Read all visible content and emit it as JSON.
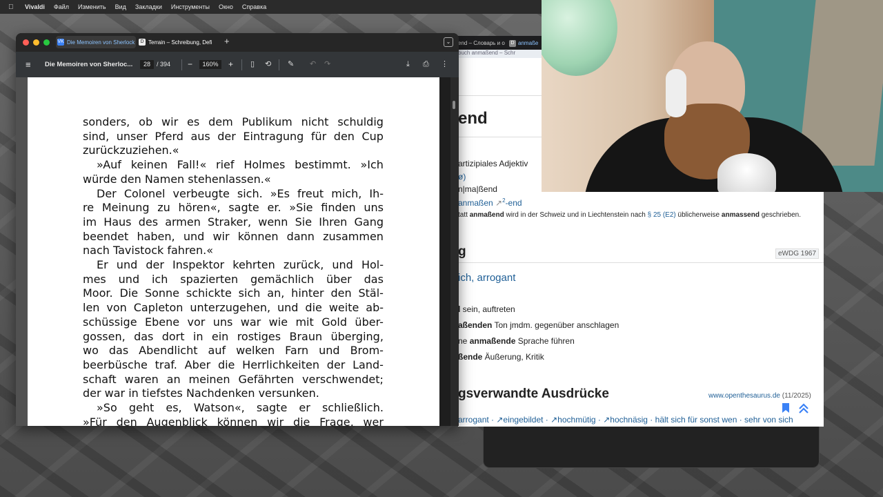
{
  "menubar": {
    "app": "Vivaldi",
    "items": [
      "Файл",
      "Изменить",
      "Вид",
      "Закладки",
      "Инструменты",
      "Окно",
      "Справка"
    ]
  },
  "browser": {
    "tabs": [
      {
        "favicon": "VK",
        "title": "Die Memoiren von Sherlock"
      },
      {
        "favicon": "D",
        "title": "Terrain – Schreibung, Defi"
      }
    ]
  },
  "pdf_toolbar": {
    "title": "Die Memoiren von Sherloc...",
    "page": "28",
    "total": "/ 394",
    "zoom": "160%"
  },
  "pdf_text": [
    "sonders, ob wir es dem Publikum nicht schuldig",
    "sind, unser Pferd aus der Eintragung für den Cup",
    "zurückzuziehen.«",
    "»Auf keinen Fall!« rief Holmes bestimmt. »Ich",
    "würde den Namen stehenlassen.«",
    "Der Colonel verbeugte sich. »Es freut mich, Ih-",
    "re Meinung zu hören«, sagte er. »Sie finden uns",
    "im Haus des armen Straker, wenn Sie Ihren Gang",
    "beendet haben, und wir können dann zusammen",
    "nach Tavistock fahren.«",
    "Er und der Inspektor kehrten zurück, und Hol-",
    "mes und ich spazierten gemächlich über das",
    "Moor. Die Sonne schickte sich an, hinter den Stäl-",
    "len von Capleton unterzugehen, und die weite ab-",
    "schüssige Ebene vor uns war wie mit Gold über-",
    "gossen, das dort in ein rostiges Braun überging,",
    "wo das Abendlicht auf welken Farn und Brom-",
    "beerbüsche traf. Aber die Herrlichkeiten der Land-",
    "schaft waren an meinen Gefährten verschwendet;",
    "der war in tiefstes Nachdenken versunken.",
    "»So geht es, Watson«, sagte er schließlich.",
    "»Für den Augenblick können wir die Frage, wer"
  ],
  "pdf_line_kinds": [
    "j",
    "j",
    "l",
    "ji",
    "l",
    "ji",
    "j",
    "j",
    "j",
    "l",
    "ji",
    "j",
    "j",
    "j",
    "j",
    "j",
    "j",
    "j",
    "j",
    "l",
    "ji",
    "j"
  ],
  "dictionary": {
    "tab_partial": "end – Словарь и о",
    "tab3": "anmaße",
    "crumb": "buch    anmaßend – Schr",
    "headword": "end",
    "pos": "artizipiales Adjektiv",
    "num": "ø)",
    "syllab": "n|ma|ßend",
    "deriv_link": "anmaßen",
    "deriv_suffix": "-end",
    "note_pre": "tatt ",
    "note_b1": "anmaßend",
    "note_mid": " wird in der Schweiz und in Liechtenstein nach ",
    "note_link": "§ 25 (E2)",
    "note_mid2": " üblicherweise ",
    "note_b2": "anmassend",
    "note_post": " geschrieben.",
    "section1": "g",
    "section1_badge": "eWDG 1967",
    "meaning": "ich, arrogant",
    "ex1_a": "l",
    "ex1_b": " sein, auftreten",
    "ex2_a": "aßenden",
    "ex2_b": " Ton jmdm. gegenüber anschlagen",
    "ex3_a": "ne ",
    "ex3_b": "anmaßende",
    "ex3_c": " Sprache führen",
    "ex4_a": "ßende",
    "ex4_b": " Äußerung, Kritik",
    "section2": "gsverwandte Ausdrücke",
    "section2_src": "www.openthesaurus.de",
    "section2_date": " (11/2025)",
    "synonyms": "arrogant · ↗eingebildet · ↗hochmütig · ↗hochnäsig · hält sich für sonst wen · sehr von sich"
  },
  "colors": {
    "accent": "#3b82f6",
    "dict_link": "#1f5f96"
  }
}
